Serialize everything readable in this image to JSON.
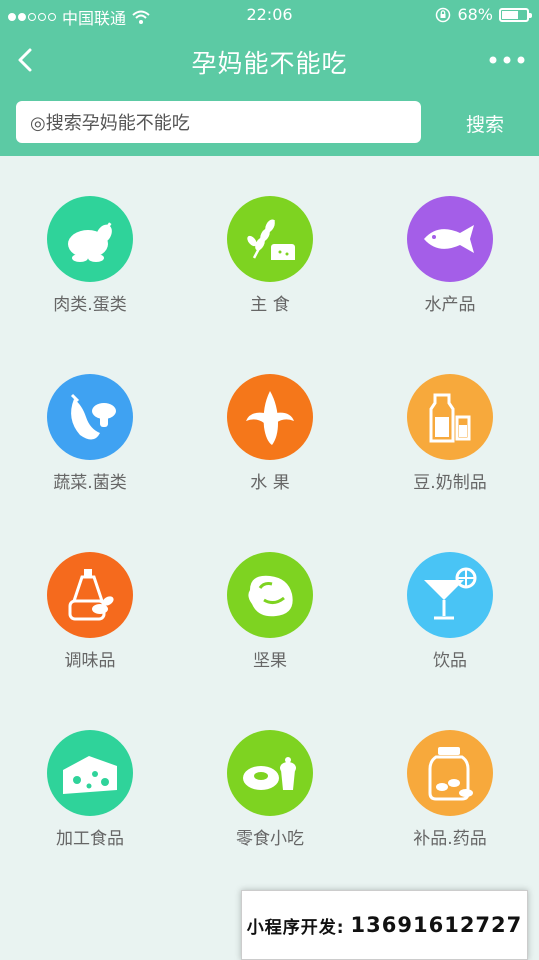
{
  "status_bar": {
    "carrier": "中国联通",
    "time": "22:06",
    "battery": "68%",
    "battery_level": 0.68
  },
  "nav": {
    "title": "孕妈能不能吃",
    "back_icon": "chevron-left-icon",
    "more_icon": "more-dots-icon"
  },
  "search": {
    "placeholder": "◎搜索孕妈能不能吃",
    "button_label": "搜索"
  },
  "categories": [
    {
      "label": "肉类.蛋类",
      "color": "#2fd39a",
      "icon": "chicken-icon"
    },
    {
      "label": "主 食",
      "color": "#7ed321",
      "icon": "grain-bread-icon"
    },
    {
      "label": "水产品",
      "color": "#a45ee8",
      "icon": "fish-icon"
    },
    {
      "label": "蔬菜.菌类",
      "color": "#3fa2f2",
      "icon": "eggplant-mushroom-icon"
    },
    {
      "label": "水 果",
      "color": "#f5771a",
      "icon": "banana-icon"
    },
    {
      "label": "豆.奶制品",
      "color": "#f7a93c",
      "icon": "milk-icon"
    },
    {
      "label": "调味品",
      "color": "#f56a1d",
      "icon": "oil-bottle-icon"
    },
    {
      "label": "坚果",
      "color": "#7ed321",
      "icon": "nut-icon"
    },
    {
      "label": "饮品",
      "color": "#49c4f5",
      "icon": "cocktail-icon"
    },
    {
      "label": "加工食品",
      "color": "#2fd39a",
      "icon": "cheese-icon"
    },
    {
      "label": "零食小吃",
      "color": "#7ed321",
      "icon": "donut-icon"
    },
    {
      "label": "补品.药品",
      "color": "#f7a93c",
      "icon": "pill-jar-icon"
    }
  ],
  "banner": {
    "prefix": "小程序开发:",
    "phone": "13691612727"
  }
}
